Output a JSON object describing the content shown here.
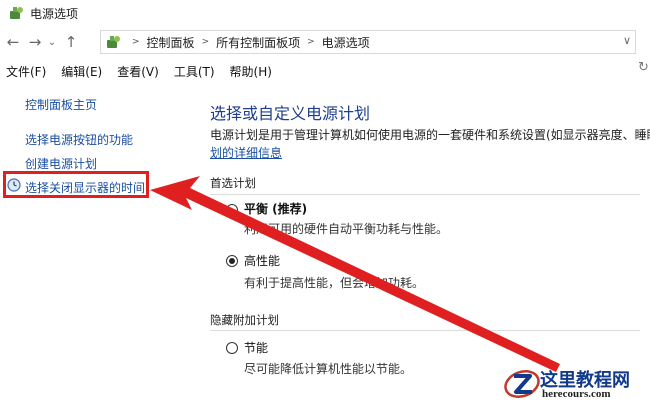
{
  "window": {
    "title": "电源选项"
  },
  "nav": {
    "breadcrumbs": [
      "控制面板",
      "所有控制面板项",
      "电源选项"
    ]
  },
  "menu": {
    "items": [
      "文件(F)",
      "编辑(E)",
      "查看(V)",
      "工具(T)",
      "帮助(H)"
    ]
  },
  "sidebar": {
    "home": "控制面板主页",
    "items": [
      {
        "label": "选择电源按钮的功能"
      },
      {
        "label": "创建电源计划"
      },
      {
        "label": "选择关闭显示器的时间"
      }
    ]
  },
  "main": {
    "heading": "选择或自定义电源计划",
    "description": "电源计划是用于管理计算机如何使用电源的一套硬件和系统设置(如显示器亮度、睡眠等)",
    "description_link": "划的详细信息",
    "preferred_label": "首选计划",
    "hidden_label": "隐藏附加计划",
    "plans": [
      {
        "name": "平衡 (推荐)",
        "desc": "利用可用的硬件自动平衡功耗与性能。",
        "selected": false
      },
      {
        "name": "高性能",
        "desc": "有利于提高性能，但会增加功耗。",
        "selected": true
      },
      {
        "name": "节能",
        "desc": "尽可能降低计算机性能以节能。",
        "selected": false
      }
    ]
  },
  "watermark": {
    "title": "这里教程网",
    "url": "herecours.com"
  },
  "colors": {
    "accent": "#e02020",
    "link": "#1a4ea0",
    "heading": "#1e3f8f"
  }
}
